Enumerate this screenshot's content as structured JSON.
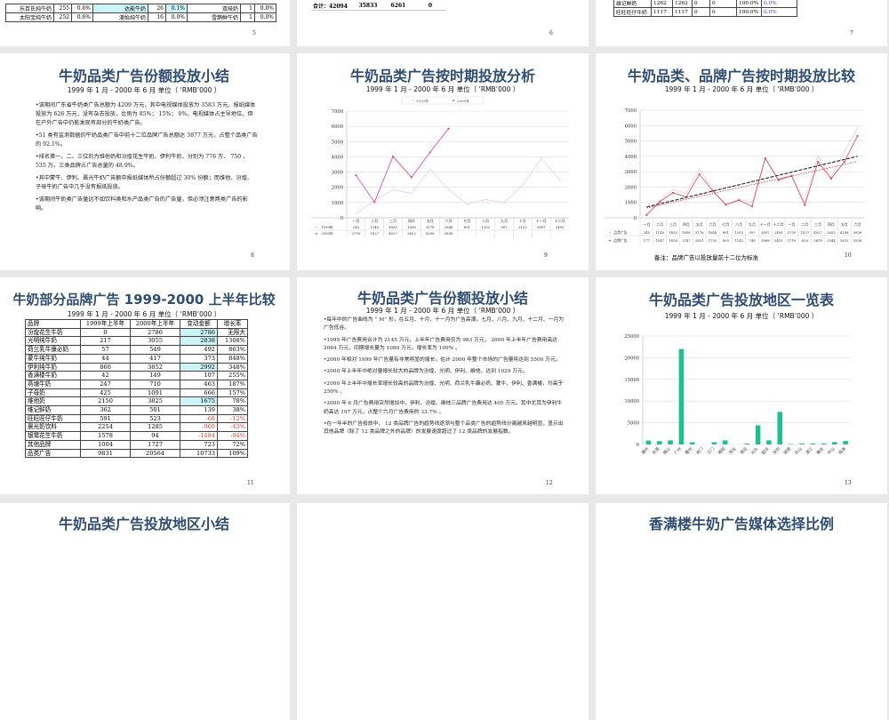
{
  "slides": {
    "s5": {
      "number": "5",
      "rows": [
        [
          "乐百氏纯牛奶",
          "255",
          "0.6%",
          "达能牛奶",
          "26",
          "0.1%",
          "双岐奶",
          "1",
          "0.0%"
        ],
        [
          "太阳宝纯牛奶",
          "252",
          "0.6%",
          "澳怡纯牛奶",
          "16",
          "0.0%",
          "雪鹊鲜牛奶",
          "1",
          "0.0%"
        ]
      ]
    },
    "s6": {
      "number": "6",
      "total_row": [
        "合计：42094",
        "35833",
        "6261",
        "0"
      ]
    },
    "s7": {
      "number": "7",
      "rows": [
        [
          "维记鲜奶",
          "1262",
          "1262",
          "0",
          "0",
          "100.0%",
          "0.0%"
        ],
        [
          "旺旺旺仔牛奶",
          "1117",
          "1117",
          "0",
          "0",
          "100.0%",
          "0.0%"
        ]
      ]
    },
    "s8": {
      "number": "8",
      "title": "牛奶品类广告份额投放小结",
      "subtitle": "1999 年 1 月 -  2000 年 6 月  单位（ ‘RMB’000 ）",
      "bullets": [
        "•该期间广东省牛奶类广告总额为 4209 万元，其中电视媒体投放为 3583 万元，报纸媒体投放为 626 万元，没有杂志投放，比例为 85%； 15%； 0%。电视媒体占主导地位。但在户外广告中仍能发现有部分的牛奶类广告。",
        "•51 类有监测数据的牛奶品类广告中前十二位品牌广告总额达 3877 万元，占整个品类广告的 92.1%。",
        "•排名第一、二、三位的为维他奶和汾煌花生牛奶、伊利牛奶，分别为 776 万、 750 、 535 万。三类品牌占广告总量的 48.9%。",
        "•其中蒙牛、伊利、晨光牛奶广告额中报纸媒体所占份额超过 30% 份额；而维他、汾煌、子母牛奶广告中几乎没有报纸投放。",
        "•该期间牛奶类广告量远不如饮料类和水产品类广告的广告量，但必须注意两类广告的影响。"
      ]
    },
    "s9": {
      "number": "9",
      "title": "牛奶品类广告按时期投放分析",
      "subtitle": "1999 年 1 月 -  2000 年 6 月  单位（ ‘RMB’000 ）"
    },
    "s10": {
      "number": "10",
      "title": "牛奶品类、品牌广告按时期投放比较",
      "subtitle": "1999 年 1 月 -  2000 年 6 月  单位（ ‘RMB’000 ）",
      "note": "备注：品牌广告以投放量前十二位为标准"
    },
    "s11": {
      "number": "11",
      "title": "牛奶部分品牌广告 1999-2000 上半年比较",
      "subtitle": "1999 年 1 月 -  2000 年 6 月  单位（ ‘RMB’000 ）",
      "header": [
        "品牌",
        "1999年上半年",
        "2000年上半年",
        "变动金额",
        "增长率"
      ],
      "rows": [
        [
          "汾煌花生牛奶",
          "0",
          "2786",
          "2786",
          "无限大"
        ],
        [
          "光明纯牛奶",
          "217",
          "3055",
          "2838",
          "1308%"
        ],
        [
          "荷兰乳牛康必奶",
          "57",
          "549",
          "492",
          "863%"
        ],
        [
          "蒙牛纯牛奶",
          "44",
          "417",
          "373",
          "848%"
        ],
        [
          "伊利纯牛奶",
          "860",
          "3852",
          "2992",
          "348%"
        ],
        [
          "香满楼牛奶",
          "42",
          "149",
          "107",
          "255%"
        ],
        [
          "燕塘牛奶",
          "247",
          "710",
          "463",
          "187%"
        ],
        [
          "子母奶",
          "425",
          "1091",
          "666",
          "157%"
        ],
        [
          "维他奶",
          "2150",
          "3825",
          "1675",
          "78%"
        ],
        [
          "维记鲜奶",
          "362",
          "501",
          "139",
          "38%"
        ],
        [
          "旺旺旺仔牛奶",
          "591",
          "523",
          "-68",
          "-12%"
        ],
        [
          "晨光奶饮料",
          "2254",
          "1285",
          "-969",
          "-43%"
        ],
        [
          "银鹭花生牛奶",
          "1578",
          "94",
          "-1484",
          "-94%"
        ],
        [
          "其他品牌",
          "1004",
          "1727",
          "723",
          "72%"
        ],
        [
          "品类广告",
          "9831",
          "20564",
          "10733",
          "109%"
        ]
      ]
    },
    "s12": {
      "number": "12",
      "title": "牛奶品类广告份额投放小结",
      "subtitle": "1999 年 1 月 -  2000 年 6 月  单位（ ‘RMB’000 ）",
      "bullets": [
        "•每年中的广告曲线为 “ M” 形，在五月、十月、十一月为广告高潮，七月、八月、九月、十二月、一月为广告低谷。",
        "•1999 年广告费用合计为 2145 万元，上半年广告费用仅为 983 万元， 2000 年上半年广告费用高达 2064 万元，同期增长量为 1080 万元，增长率为 109% 。",
        "•2000 年相对 1999 年广告量有非常明显的增长，估计 2000 年整个市场的广告量将达到 5500 万元。",
        "•2000 年上半年中绝对量增长较大的品牌为汾煌、光明、伊利、维他，达到 1029 万元。",
        "•2000 年上半年中增长率增长较高的品牌为汾煌、光明、荷兰乳牛康必奶、蒙牛、伊利、香满楼，均高于 250% 。",
        "•2000 年 6 月广告费用突然增加中，伊利、汾煌、维他三品牌广告费用达 405 万元。其中尤其为伊利牛奶高达 197 万元，占整个六月广告费用的 33.7% 。",
        "•在一年半的广告投放中， 12 类品牌广告的趋势线逐渐与整个品类广告的趋势线分离越来越明显，显示出其他品牌（除了 12 类品牌之外的品牌）的发展速度超过了 12 类品牌的发展指数。"
      ]
    },
    "s13": {
      "number": "13",
      "title": "牛奶品类广告投放地区一览表",
      "subtitle": "1999 年 1 月 -  2000 年 6 月  单位（ ‘RMB’000 ）"
    },
    "s14": {
      "title": "牛奶品类广告投放地区小结"
    },
    "s16": {
      "title": "香满楼牛奶广告媒体选择比例"
    }
  },
  "chart_data": [
    {
      "type": "line",
      "slide": "9",
      "categories": [
        "一月",
        "二月",
        "三月",
        "四月",
        "五月",
        "六月",
        "七月",
        "八月",
        "九月",
        "十月",
        "十一月",
        "十二月"
      ],
      "series": [
        {
          "name": "1999年",
          "values": [
            245,
            1140,
            1835,
            1606,
            3176,
            1848,
            891,
            1202,
            997,
            2132,
            3897,
            2493
          ],
          "color": "#e8b8e0"
        },
        {
          "name": "2000年",
          "values": [
            2795,
            1027,
            4027,
            2652,
            4298,
            5856
          ],
          "color": "#cc2aa8"
        }
      ],
      "ylim": [
        0,
        7000
      ],
      "yticks": [
        0,
        1000,
        2000,
        3000,
        4000,
        5000,
        6000,
        7000
      ],
      "grid": true,
      "legend": "top"
    },
    {
      "type": "line",
      "slide": "10",
      "categories": [
        "一月",
        "二月",
        "三月",
        "四月",
        "五月",
        "六月",
        "七月",
        "八月",
        "九月",
        "十一月",
        "十二月",
        "一月",
        "二月",
        "三月",
        "四月",
        "五月",
        "六月"
      ],
      "series": [
        {
          "name": "品类广告",
          "values": [
            245,
            1140,
            1835,
            1606,
            3176,
            1848,
            891,
            1202,
            997,
            3897,
            2493,
            2795,
            1027,
            4027,
            2652,
            4298,
            5856
          ],
          "color": "#e8c0c8"
        },
        {
          "name": "品牌广告",
          "values": [
            177,
            1047,
            1628,
            1347,
            2831,
            1755,
            850,
            1142,
            748,
            3868,
            2455,
            2719,
            828,
            3639,
            2544,
            3632,
            5326
          ],
          "color": "#d03040"
        }
      ],
      "trendlines": true,
      "ylim": [
        0,
        7000
      ],
      "yticks": [
        0,
        1000,
        2000,
        3000,
        4000,
        5000,
        6000,
        7000
      ],
      "grid": true,
      "legend": "table"
    },
    {
      "type": "bar",
      "slide": "13",
      "categories": [
        "潮州",
        "东莞",
        "佛山",
        "广州",
        "惠州",
        "虎门",
        "江门",
        "揭阳",
        "茂名",
        "清远",
        "汕头",
        "韶关",
        "深圳",
        "顺德",
        "台山",
        "湛江",
        "肇庆",
        "中山",
        "珠海"
      ],
      "values": [
        900,
        750,
        950,
        22000,
        500,
        0,
        500,
        950,
        0,
        200,
        4400,
        950,
        7500,
        100,
        200,
        200,
        200,
        550,
        800
      ],
      "color": "#1fbf8f",
      "ylim": [
        0,
        25000
      ],
      "yticks": [
        0,
        5000,
        10000,
        15000,
        20000,
        25000
      ],
      "grid": true
    }
  ]
}
